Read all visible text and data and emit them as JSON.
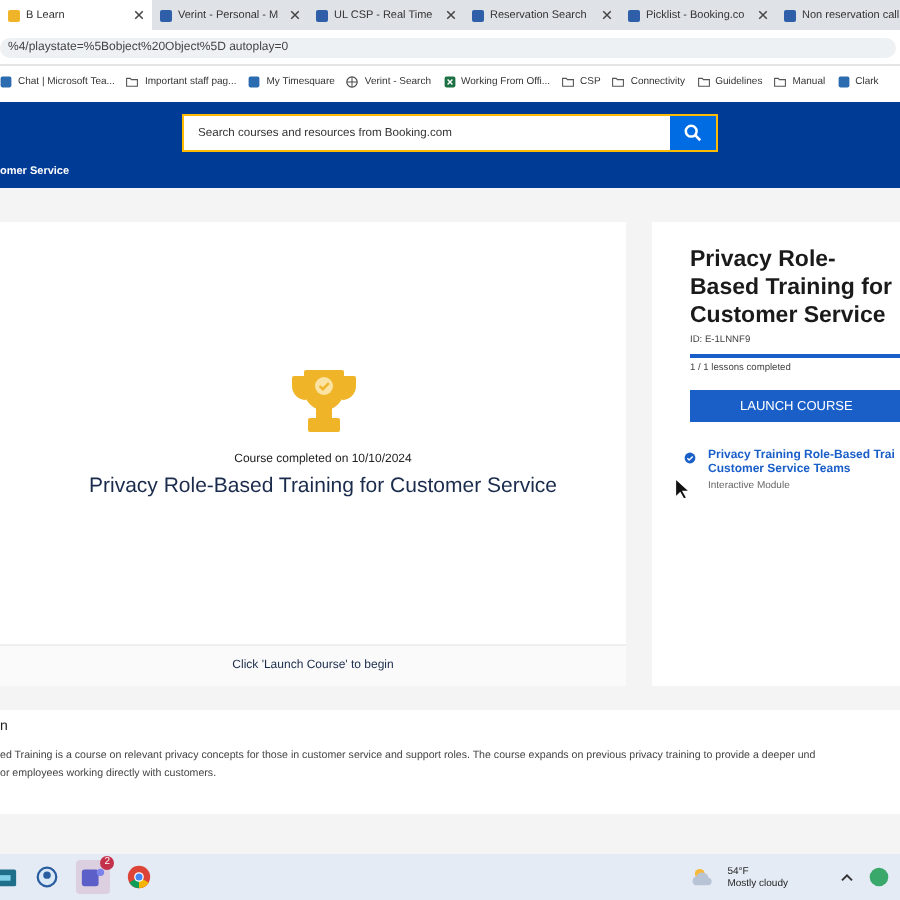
{
  "browser": {
    "tabs": [
      {
        "label": "B Learn",
        "selected": true
      },
      {
        "label": "Verint - Personal - M",
        "selected": false
      },
      {
        "label": "UL CSP - Real Time",
        "selected": false
      },
      {
        "label": "Reservation Search",
        "selected": false
      },
      {
        "label": "Picklist - Booking.co",
        "selected": false
      },
      {
        "label": "Non reservation call",
        "selected": false
      }
    ],
    "address": "%4/playstate=%5Bobject%20Object%5D autoplay=0",
    "bookmarks": [
      {
        "label": "Chat | Microsoft Tea...",
        "kind": "page"
      },
      {
        "label": "Important staff pag...",
        "kind": "folder"
      },
      {
        "label": "My Timesquare",
        "kind": "page"
      },
      {
        "label": "Verint - Search",
        "kind": "globe"
      },
      {
        "label": "Working From Offi...",
        "kind": "sheet"
      },
      {
        "label": "CSP",
        "kind": "folder"
      },
      {
        "label": "Connectivity",
        "kind": "folder"
      },
      {
        "label": "Guidelines",
        "kind": "folder"
      },
      {
        "label": "Manual",
        "kind": "folder"
      },
      {
        "label": "Clark",
        "kind": "page"
      }
    ]
  },
  "header": {
    "search": {
      "placeholder": "Search courses and resources from Booking.com"
    },
    "breadcrumb": "omer Service"
  },
  "player": {
    "completed_note": "Course completed on 10/10/2024",
    "title": "Privacy Role-Based Training for Customer Service",
    "footer": "Click 'Launch Course' to begin"
  },
  "course": {
    "title": "Privacy Role-Based Training for Customer Service",
    "id": "ID: E-1LNNF9",
    "progress": {
      "level": 1,
      "reading": "1 / 1 lessons completed"
    },
    "launch_button": "LAUNCH COURSE",
    "modules": [
      {
        "title_lines": [
          "Privacy Training Role-Based Trai",
          "Customer Service Teams"
        ],
        "type": "Interactive Module",
        "completed": true
      }
    ]
  },
  "description": {
    "heading": "n",
    "lines": [
      "ed Training is a course on relevant privacy concepts for those in customer service and support roles. The course expands on previous privacy training to provide a deeper und",
      "or employees working directly with customers."
    ]
  },
  "taskbar": {
    "teams_badge": "2",
    "weather": {
      "temp": "54°F",
      "condition": "Mostly cloudy"
    }
  }
}
